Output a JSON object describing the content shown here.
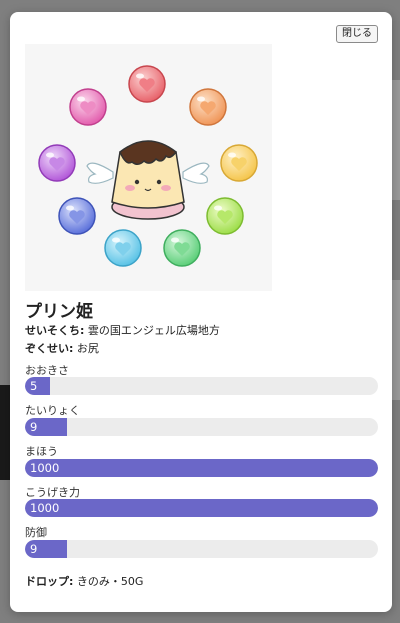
{
  "modal": {
    "close_label": "閉じる",
    "name": "プリン姫",
    "habitat_label": "せいそくち:",
    "habitat_value": "雲の国エンジェル広場地方",
    "race_label": "ぞくせい:",
    "race_value": "お尻",
    "stats": [
      {
        "label": "おおきさ",
        "value": "5",
        "fill": 0.07
      },
      {
        "label": "たいりょく",
        "value": "9",
        "fill": 0.12
      },
      {
        "label": "まほう",
        "value": "1000",
        "fill": 1.0
      },
      {
        "label": "こうげき力",
        "value": "1000",
        "fill": 1.0
      },
      {
        "label": "防御",
        "value": "9",
        "fill": 0.12
      }
    ],
    "drop_label": "ドロップ:",
    "drop_value": "きのみ・50G"
  },
  "colors": {
    "bar_fill": "#6b67c8",
    "bar_track": "#ececec"
  },
  "portrait": {
    "orbs": [
      "red-orb",
      "orange-orb",
      "yellow-orb",
      "lime-orb",
      "green-orb",
      "cyan-orb",
      "blue-orb",
      "purple-orb",
      "pink-orb"
    ]
  }
}
